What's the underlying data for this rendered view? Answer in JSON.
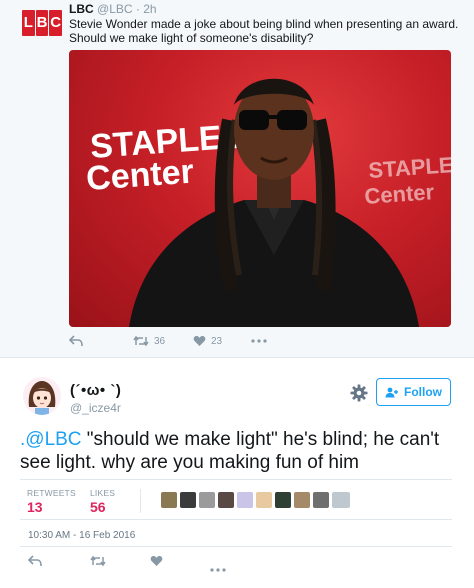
{
  "quoted_tweet": {
    "logo_letters": [
      "L",
      "B",
      "C"
    ],
    "name": "LBC",
    "handle": "@LBC",
    "separator": "·",
    "time": "2h",
    "text": "Stevie Wonder made a joke about being blind when presenting an award. Should we make light of someone's disability?",
    "photo": {
      "backdrop_text_left": [
        "STAPLES",
        "Center"
      ],
      "backdrop_text_right": [
        "STAPLES",
        "Center"
      ],
      "backdrop_color": "#c61f27"
    },
    "actions": {
      "retweets": "36",
      "likes": "23",
      "icons": [
        "reply-icon",
        "retweet-icon",
        "heart-icon",
        "more-icon"
      ]
    }
  },
  "tweet": {
    "display_name": "(´•ω• `)",
    "handle": "@_icze4r",
    "follow_label": "Follow",
    "mention": ".@LBC",
    "text": " \"should we make light\" he's blind; he can't see light. why are you making fun of him",
    "retweets_label": "RETWEETS",
    "retweets": "13",
    "likes_label": "LIKES",
    "likes": "56",
    "timestamp": "10:30 AM - 16 Feb 2016",
    "liker_avatar_count": 10
  },
  "colors": {
    "brand_blue": "#1da1f2",
    "like_red": "#e0245e",
    "lbc_red": "#d81e2a",
    "muted": "#8899a6"
  }
}
